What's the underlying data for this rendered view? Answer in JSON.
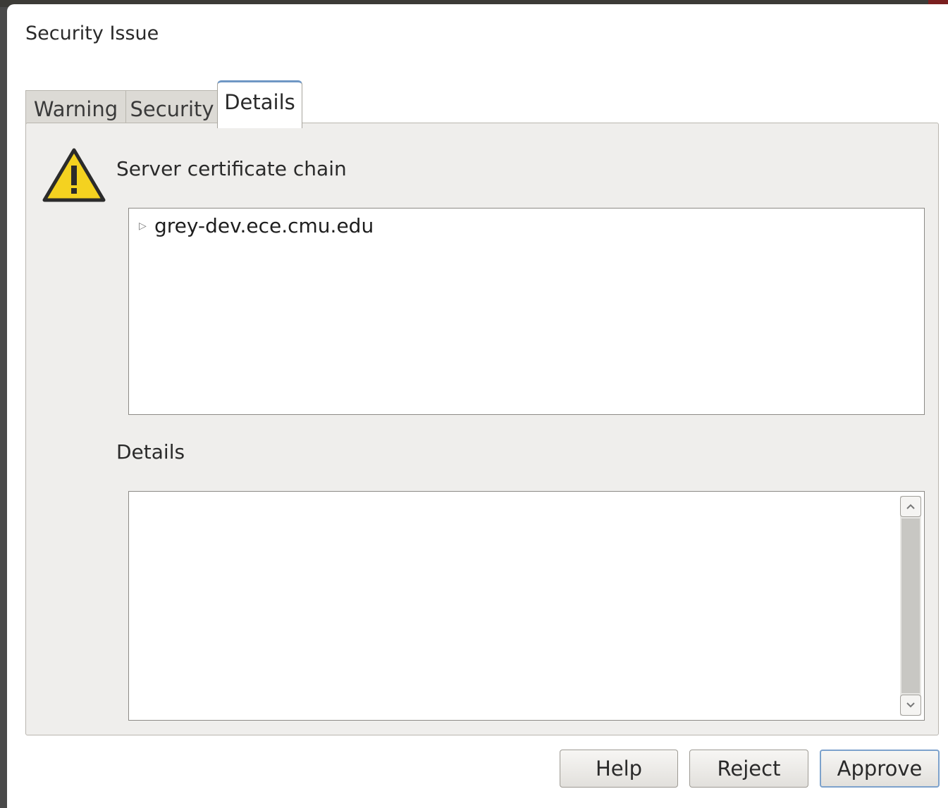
{
  "dialog": {
    "title": "Security Issue"
  },
  "tabs": [
    {
      "label": "Warning",
      "active": false
    },
    {
      "label": "Security",
      "active": false
    },
    {
      "label": "Details",
      "active": true
    }
  ],
  "details_tab": {
    "chain_label": "Server certificate chain",
    "chain_items": [
      {
        "label": "grey-dev.ece.cmu.edu",
        "expander_icon": "triangle-right-icon"
      }
    ],
    "details_label": "Details",
    "details_text": ""
  },
  "buttons": {
    "help": "Help",
    "reject": "Reject",
    "approve": "Approve"
  },
  "icons": {
    "warning": "warning-triangle-icon",
    "scroll_up": "chevron-up-icon",
    "scroll_down": "chevron-down-icon"
  },
  "colors": {
    "warning_fill": "#f4d220",
    "active_tab_accent": "#6f97c4",
    "default_button_border": "#7da2cc"
  }
}
